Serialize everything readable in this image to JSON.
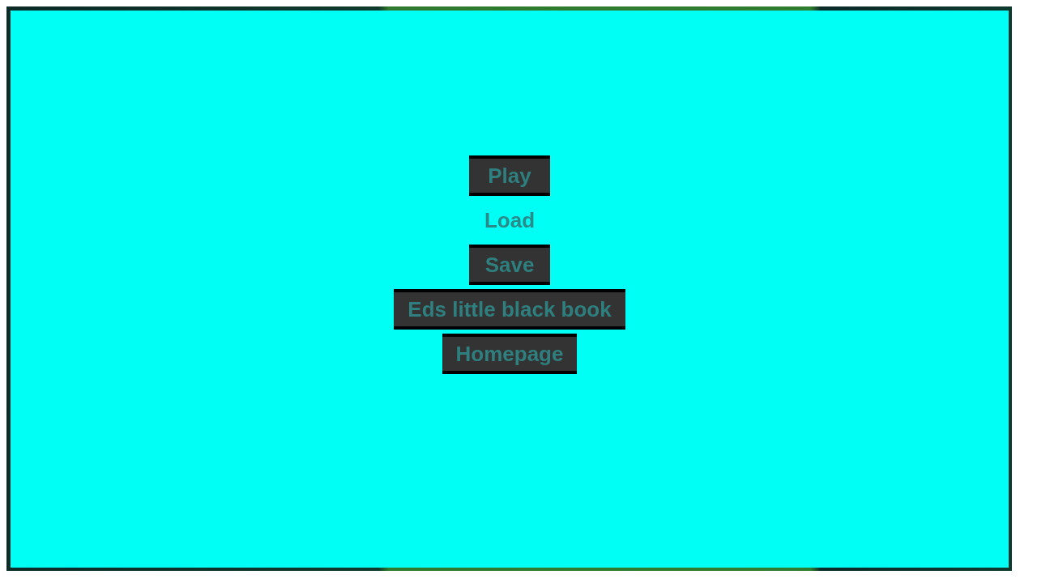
{
  "menu": {
    "buttons": [
      {
        "label": "Play",
        "disabled": false
      },
      {
        "label": "Load",
        "disabled": true
      },
      {
        "label": "Save",
        "disabled": false
      },
      {
        "label": "Eds little black book",
        "disabled": false
      },
      {
        "label": "Homepage",
        "disabled": false
      }
    ]
  }
}
